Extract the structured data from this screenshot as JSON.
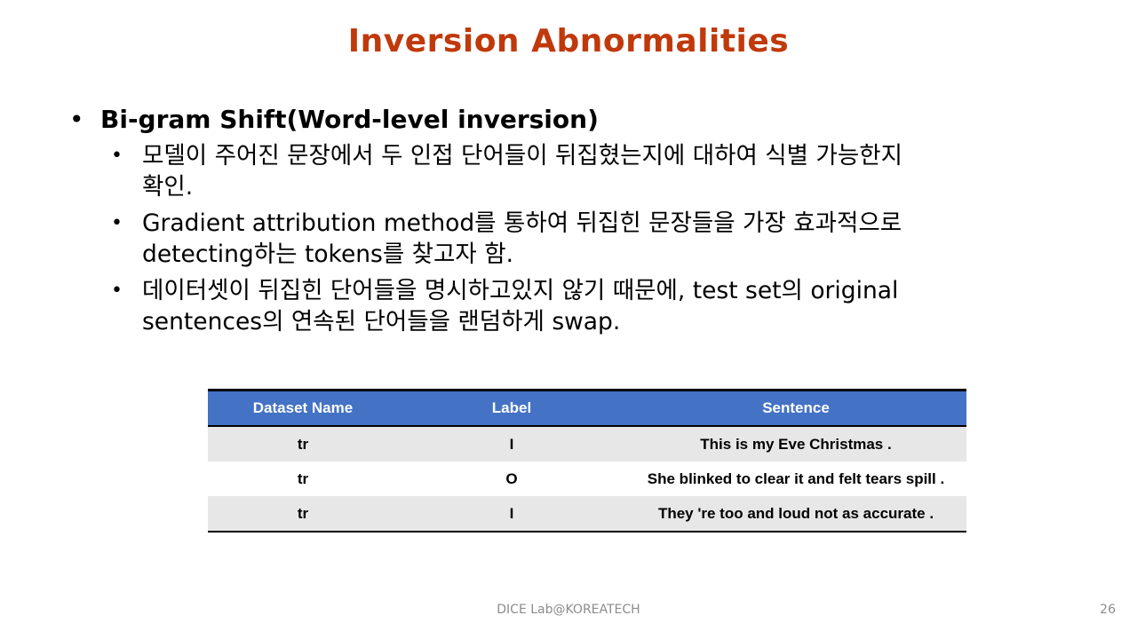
{
  "slide": {
    "title": "Inversion Abnormalities",
    "bullet_main": "Bi-gram Shift(Word-level inversion)",
    "sub_bullets": [
      {
        "line1": "모델이 주어진 문장에서 두 인접 단어들이 뒤집혔는지에 대하여 식별 가능한지",
        "line2": "확인."
      },
      {
        "line1": "Gradient attribution method를 통하여 뒤집힌 문장들을 가장 효과적으로",
        "line2": "detecting하는 tokens를 찾고자 함."
      },
      {
        "line1": "데이터셋이 뒤집힌 단어들을 명시하고있지 않기 때문에, test set의 original",
        "line2": "sentences의 연속된 단어들을 랜덤하게 swap."
      }
    ],
    "bullet_char": "•"
  },
  "table": {
    "headers": {
      "name": "Dataset Name",
      "label": "Label",
      "sentence": "Sentence"
    },
    "rows": [
      {
        "name": "tr",
        "label": "I",
        "sentence": "This is my Eve Christmas ."
      },
      {
        "name": "tr",
        "label": "O",
        "sentence": "She blinked to clear it and felt tears spill ."
      },
      {
        "name": "tr",
        "label": "I",
        "sentence": "They 're too and loud not as accurate ."
      }
    ],
    "header_color": "#4472c4",
    "shade_color": "#e7e7e7"
  },
  "footer": {
    "text": "DICE Lab@KOREATECH",
    "page": "26"
  },
  "colors": {
    "title": "#c0390b"
  }
}
